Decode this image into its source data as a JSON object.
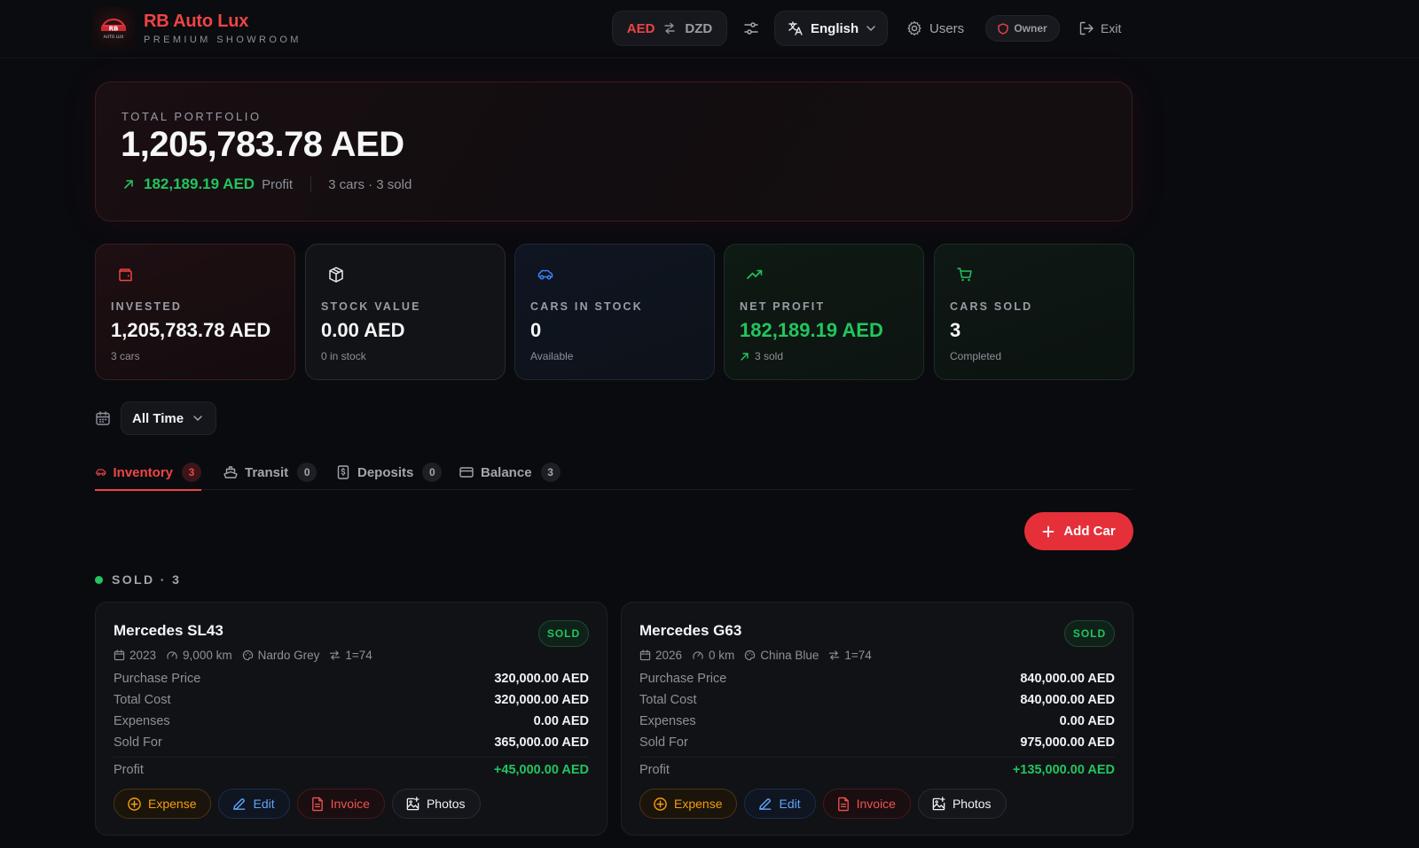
{
  "header": {
    "brand_name": "RB Auto Lux",
    "brand_sub": "PREMIUM SHOWROOM",
    "currency_primary": "AED",
    "currency_secondary": "DZD",
    "language": "English",
    "users_label": "Users",
    "role_badge": "Owner",
    "exit_label": "Exit"
  },
  "portfolio": {
    "label": "TOTAL PORTFOLIO",
    "total": "1,205,783.78 AED",
    "profit": "182,189.19 AED",
    "profit_label": "Profit",
    "meta": "3 cars · 3 sold"
  },
  "stats": {
    "invested": {
      "label": "INVESTED",
      "value": "1,205,783.78 AED",
      "sub": "3 cars"
    },
    "stock_value": {
      "label": "STOCK VALUE",
      "value": "0.00 AED",
      "sub": "0 in stock"
    },
    "cars_in_stock": {
      "label": "CARS IN STOCK",
      "value": "0",
      "sub": "Available"
    },
    "net_profit": {
      "label": "NET PROFIT",
      "value": "182,189.19 AED",
      "sub": "3 sold"
    },
    "cars_sold": {
      "label": "CARS SOLD",
      "value": "3",
      "sub": "Completed"
    }
  },
  "filter": {
    "period": "All Time"
  },
  "tabs": [
    {
      "label": "Inventory",
      "count": "3"
    },
    {
      "label": "Transit",
      "count": "0"
    },
    {
      "label": "Deposits",
      "count": "0"
    },
    {
      "label": "Balance",
      "count": "3"
    }
  ],
  "add_car_label": "Add Car",
  "section": {
    "title": "SOLD · 3"
  },
  "row_labels": {
    "purchase_price": "Purchase Price",
    "total_cost": "Total Cost",
    "expenses": "Expenses",
    "sold_for": "Sold For",
    "profit": "Profit"
  },
  "actions": {
    "expense": "Expense",
    "edit": "Edit",
    "invoice": "Invoice",
    "photos": "Photos"
  },
  "cars": [
    {
      "name": "Mercedes SL43",
      "status": "SOLD",
      "year": "2023",
      "mileage": "9,000 km",
      "color": "Nardo Grey",
      "rate": "1=74",
      "purchase_price": "320,000.00 AED",
      "total_cost": "320,000.00 AED",
      "expenses": "0.00 AED",
      "sold_for": "365,000.00 AED",
      "profit": "+45,000.00 AED"
    },
    {
      "name": "Mercedes G63",
      "status": "SOLD",
      "year": "2026",
      "mileage": "0 km",
      "color": "China Blue",
      "rate": "1=74",
      "purchase_price": "840,000.00 AED",
      "total_cost": "840,000.00 AED",
      "expenses": "0.00 AED",
      "sold_for": "975,000.00 AED",
      "profit": "+135,000.00 AED"
    }
  ],
  "colors": {
    "accent": "#ef4444",
    "success": "#22c55e",
    "warning": "#f59e0b",
    "info": "#60a5fa",
    "background": "#0a0b0f"
  }
}
